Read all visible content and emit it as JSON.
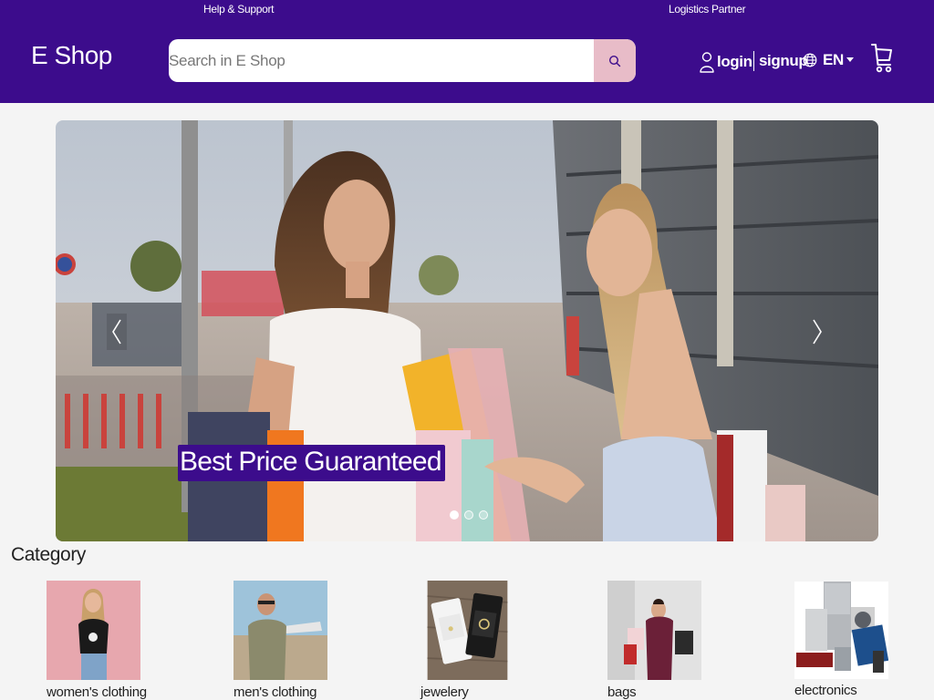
{
  "header": {
    "help_link": "Help & Support",
    "logistics_link": "Logistics Partner",
    "logo": "E Shop",
    "search_placeholder": "Search in E Shop",
    "login_label": "login",
    "signup_label": "signup",
    "language_label": "EN",
    "icons": [
      "search-icon",
      "user-icon",
      "globe-icon",
      "caret-down-icon",
      "cart-icon"
    ]
  },
  "carousel": {
    "caption": "Best Price Guaranteed",
    "slide_count": 3,
    "active_slide": 1
  },
  "category": {
    "title": "Category",
    "items": [
      {
        "label": "women's clothing"
      },
      {
        "label": "men's clothing"
      },
      {
        "label": "jewelery"
      },
      {
        "label": "bags"
      },
      {
        "label": "electronics"
      }
    ]
  },
  "colors": {
    "brand": "#3c0c8c",
    "search_button": "#e8bcc8",
    "background": "#f4f4f4"
  }
}
